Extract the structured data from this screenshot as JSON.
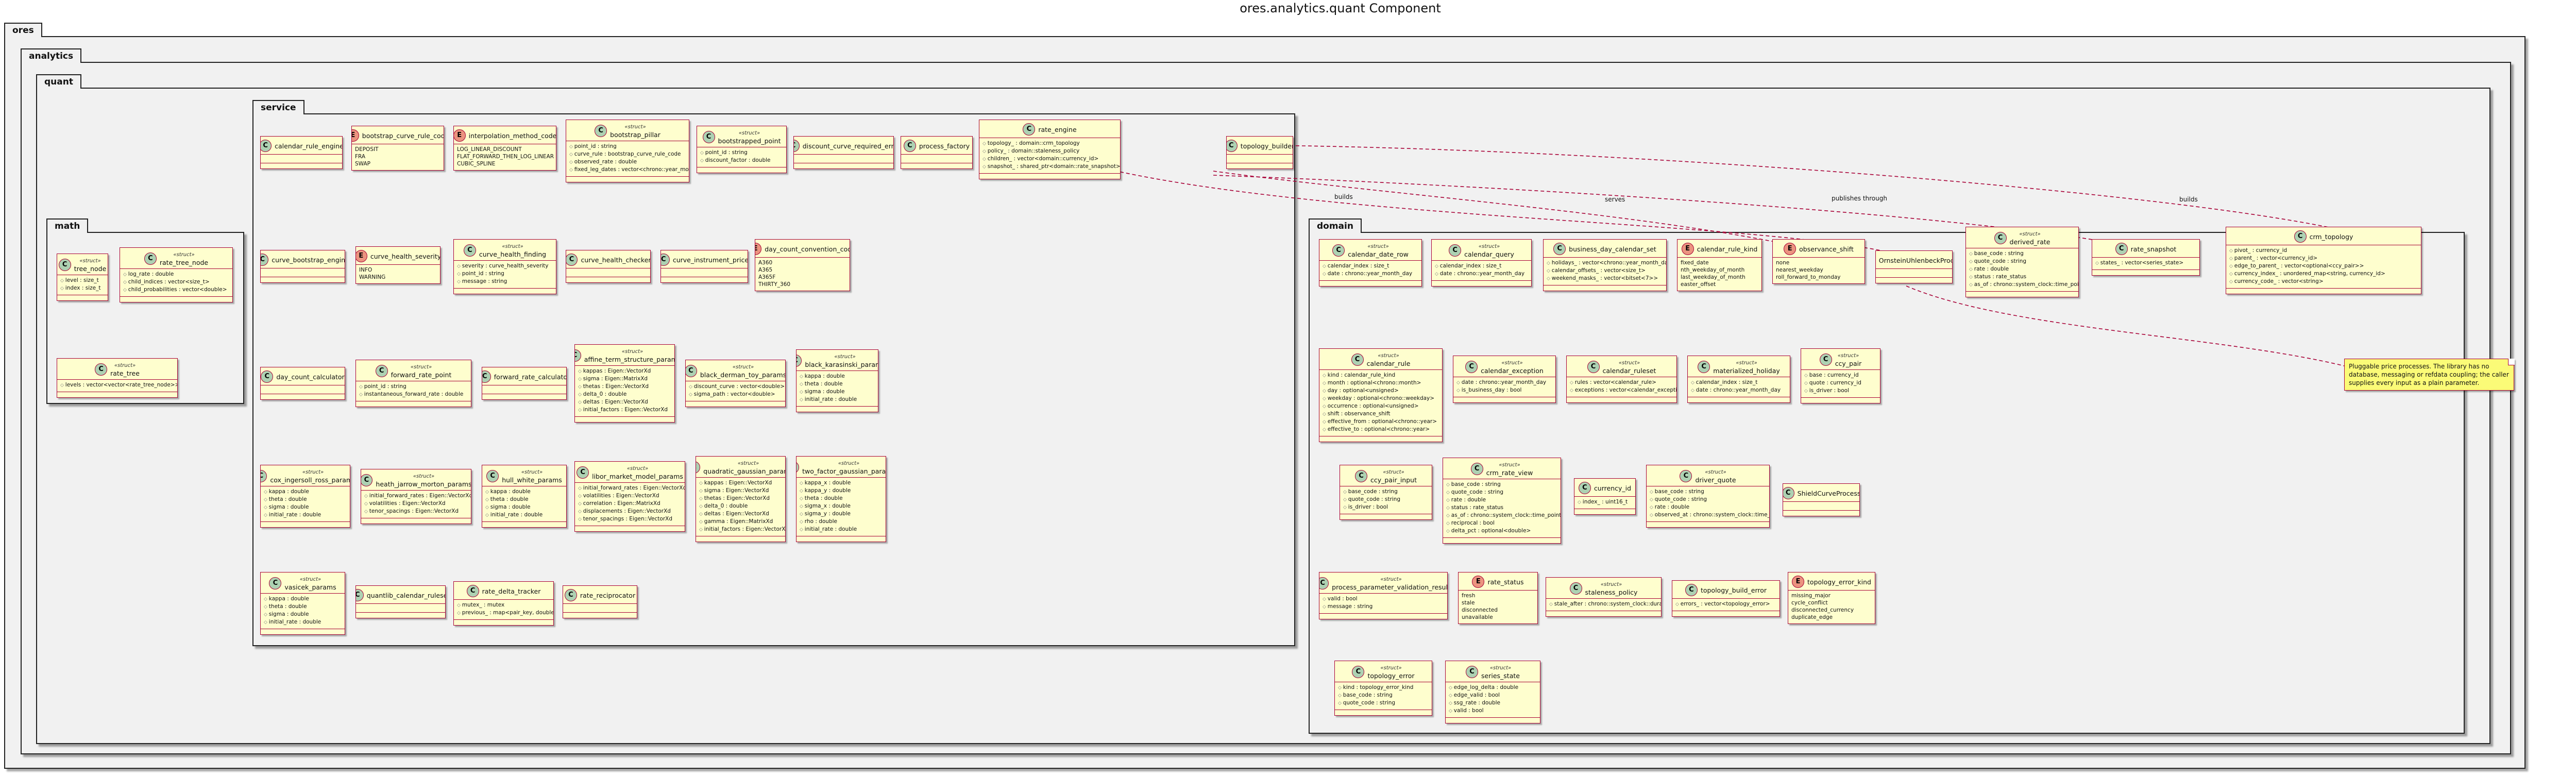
{
  "diagram": {
    "title": "ores.analytics.quant Component",
    "packages": {
      "ores": "ores",
      "analytics": "analytics",
      "quant": "quant",
      "math": "math",
      "service": "service",
      "domain": "domain"
    },
    "classes": {
      "tree_node": {
        "kind": "C",
        "stereotype": "«struct»",
        "name": "tree_node",
        "fields": [
          "level : size_t",
          "index : size_t"
        ]
      },
      "rate_tree_node": {
        "kind": "C",
        "stereotype": "«struct»",
        "name": "rate_tree_node",
        "fields": [
          "log_rate : double",
          "child_indices : vector<size_t>",
          "child_probabilities : vector<double>"
        ]
      },
      "rate_tree": {
        "kind": "C",
        "stereotype": "«struct»",
        "name": "rate_tree",
        "fields": [
          "levels : vector<vector<rate_tree_node>>"
        ]
      },
      "calendar_rule_engine": {
        "kind": "C",
        "name": "calendar_rule_engine",
        "fields": []
      },
      "bootstrap_curve_rule_code": {
        "kind": "E",
        "name": "bootstrap_curve_rule_code",
        "literals": [
          "DEPOSIT",
          "FRA",
          "SWAP"
        ]
      },
      "interpolation_method_code": {
        "kind": "E",
        "name": "interpolation_method_code",
        "literals": [
          "LOG_LINEAR_DISCOUNT",
          "FLAT_FORWARD_THEN_LOG_LINEAR",
          "CUBIC_SPLINE"
        ]
      },
      "bootstrap_pillar": {
        "kind": "C",
        "stereotype": "«struct»",
        "name": "bootstrap_pillar",
        "fields": [
          "point_id : string",
          "curve_rule : bootstrap_curve_rule_code",
          "observed_rate : double",
          "fixed_leg_dates : vector<chrono::year_month_day>"
        ]
      },
      "bootstrapped_point": {
        "kind": "C",
        "stereotype": "«struct»",
        "name": "bootstrapped_point",
        "fields": [
          "point_id : string",
          "discount_factor : double"
        ]
      },
      "discount_curve_required_error": {
        "kind": "C",
        "name": "discount_curve_required_error",
        "fields": []
      },
      "process_factory": {
        "kind": "C",
        "name": "process_factory",
        "fields": []
      },
      "rate_engine": {
        "kind": "C",
        "name": "rate_engine",
        "fields": [
          "topology_ : domain::crm_topology",
          "policy_ : domain::staleness_policy",
          "children_ : vector<domain::currency_id>",
          "snapshot_ : shared_ptr<domain::rate_snapshot>"
        ]
      },
      "topology_builder": {
        "kind": "C",
        "name": "topology_builder",
        "fields": []
      },
      "curve_bootstrap_engine": {
        "kind": "C",
        "name": "curve_bootstrap_engine",
        "fields": []
      },
      "curve_health_severity": {
        "kind": "E",
        "name": "curve_health_severity",
        "literals": [
          "INFO",
          "WARNING"
        ]
      },
      "curve_health_finding": {
        "kind": "C",
        "stereotype": "«struct»",
        "name": "curve_health_finding",
        "fields": [
          "severity : curve_health_severity",
          "point_id : string",
          "message : string"
        ]
      },
      "curve_health_checker": {
        "kind": "C",
        "name": "curve_health_checker",
        "fields": []
      },
      "curve_instrument_pricer": {
        "kind": "C",
        "name": "curve_instrument_pricer",
        "fields": []
      },
      "day_count_convention_code": {
        "kind": "E",
        "name": "day_count_convention_code",
        "literals": [
          "A360",
          "A365",
          "A365F",
          "THIRTY_360"
        ]
      },
      "day_count_calculator": {
        "kind": "C",
        "name": "day_count_calculator",
        "fields": []
      },
      "forward_rate_point": {
        "kind": "C",
        "stereotype": "«struct»",
        "name": "forward_rate_point",
        "fields": [
          "point_id : string",
          "instantaneous_forward_rate : double"
        ]
      },
      "forward_rate_calculator": {
        "kind": "C",
        "name": "forward_rate_calculator",
        "fields": []
      },
      "affine_term_structure_params": {
        "kind": "C",
        "stereotype": "«struct»",
        "name": "affine_term_structure_params",
        "fields": [
          "kappas : Eigen::VectorXd",
          "sigma : Eigen::MatrixXd",
          "thetas : Eigen::VectorXd",
          "delta_0 : double",
          "deltas : Eigen::VectorXd",
          "initial_factors : Eigen::VectorXd"
        ]
      },
      "black_derman_toy_params": {
        "kind": "C",
        "stereotype": "«struct»",
        "name": "black_derman_toy_params",
        "fields": [
          "discount_curve : vector<double>",
          "sigma_path : vector<double>"
        ]
      },
      "black_karasinski_params": {
        "kind": "C",
        "stereotype": "«struct»",
        "name": "black_karasinski_params",
        "fields": [
          "kappa : double",
          "theta : double",
          "sigma : double",
          "initial_rate : double"
        ]
      },
      "cox_ingersoll_ross_params": {
        "kind": "C",
        "stereotype": "«struct»",
        "name": "cox_ingersoll_ross_params",
        "fields": [
          "kappa : double",
          "theta : double",
          "sigma : double",
          "initial_rate : double"
        ]
      },
      "heath_jarrow_morton_params": {
        "kind": "C",
        "stereotype": "«struct»",
        "name": "heath_jarrow_morton_params",
        "fields": [
          "initial_forward_rates : Eigen::VectorXd",
          "volatilities : Eigen::VectorXd",
          "tenor_spacings : Eigen::VectorXd"
        ]
      },
      "hull_white_params": {
        "kind": "C",
        "stereotype": "«struct»",
        "name": "hull_white_params",
        "fields": [
          "kappa : double",
          "theta : double",
          "sigma : double",
          "initial_rate : double"
        ]
      },
      "libor_market_model_params": {
        "kind": "C",
        "stereotype": "«struct»",
        "name": "libor_market_model_params",
        "fields": [
          "initial_forward_rates : Eigen::VectorXd",
          "volatilities : Eigen::VectorXd",
          "correlation : Eigen::MatrixXd",
          "displacements : Eigen::VectorXd",
          "tenor_spacings : Eigen::VectorXd"
        ]
      },
      "quadratic_gaussian_params": {
        "kind": "C",
        "stereotype": "«struct»",
        "name": "quadratic_gaussian_params",
        "fields": [
          "kappas : Eigen::VectorXd",
          "sigma : Eigen::VectorXd",
          "thetas : Eigen::VectorXd",
          "delta_0 : double",
          "deltas : Eigen::VectorXd",
          "gamma : Eigen::MatrixXd",
          "initial_factors : Eigen::VectorXd"
        ]
      },
      "two_factor_gaussian_params": {
        "kind": "C",
        "stereotype": "«struct»",
        "name": "two_factor_gaussian_params",
        "fields": [
          "kappa_x : double",
          "kappa_y : double",
          "theta : double",
          "sigma_x : double",
          "sigma_y : double",
          "rho : double",
          "initial_rate : double"
        ]
      },
      "vasicek_params": {
        "kind": "C",
        "stereotype": "«struct»",
        "name": "vasicek_params",
        "fields": [
          "kappa : double",
          "theta : double",
          "sigma : double",
          "initial_rate : double"
        ]
      },
      "quantlib_calendar_ruleset": {
        "kind": "C",
        "name": "quantlib_calendar_ruleset",
        "fields": []
      },
      "rate_delta_tracker": {
        "kind": "C",
        "name": "rate_delta_tracker",
        "fields": [
          "mutex_ : mutex",
          "previous_ : map<pair_key, double>"
        ]
      },
      "rate_reciprocator": {
        "kind": "C",
        "name": "rate_reciprocator",
        "fields": []
      },
      "calendar_date_row": {
        "kind": "C",
        "stereotype": "«struct»",
        "name": "calendar_date_row",
        "fields": [
          "calendar_index : size_t",
          "date : chrono::year_month_day"
        ]
      },
      "calendar_query": {
        "kind": "C",
        "stereotype": "«struct»",
        "name": "calendar_query",
        "fields": [
          "calendar_index : size_t",
          "date : chrono::year_month_day"
        ]
      },
      "business_day_calendar_set": {
        "kind": "C",
        "name": "business_day_calendar_set",
        "fields": [
          "holidays_ : vector<chrono::year_month_day>",
          "calendar_offsets_ : vector<size_t>",
          "weekend_masks_ : vector<bitset<7>>"
        ]
      },
      "calendar_rule_kind": {
        "kind": "E",
        "name": "calendar_rule_kind",
        "literals": [
          "fixed_date",
          "nth_weekday_of_month",
          "last_weekday_of_month",
          "easter_offset"
        ]
      },
      "observance_shift": {
        "kind": "E",
        "name": "observance_shift",
        "literals": [
          "none",
          "nearest_weekday",
          "roll_forward_to_monday"
        ]
      },
      "sheet_nameless_placeholder": {
        "kind": "C",
        "name": "OrnsteinUhlenbeckProcess",
        "fields": []
      },
      "crm_topology": {
        "kind": "C",
        "name": "crm_topology",
        "fields": [
          "pivot_ : currency_id",
          "parent_ : vector<currency_id>",
          "edge_to_parent_ : vector<optional<ccy_pair>>",
          "currency_index_ : unordered_map<string, currency_id>",
          "currency_code_ : vector<string>"
        ]
      },
      "derived_rate": {
        "kind": "C",
        "stereotype": "«struct»",
        "name": "derived_rate",
        "fields": [
          "base_code : string",
          "quote_code : string",
          "rate : double",
          "status : rate_status",
          "as_of : chrono::system_clock::time_point"
        ]
      },
      "rate_snapshot": {
        "kind": "C",
        "name": "rate_snapshot",
        "fields": [
          "states_ : vector<series_state>"
        ]
      },
      "calendar_rule": {
        "kind": "C",
        "stereotype": "«struct»",
        "name": "calendar_rule",
        "fields": [
          "kind : calendar_rule_kind",
          "month : optional<chrono::month>",
          "day : optional<unsigned>",
          "weekday : optional<chrono::weekday>",
          "occurrence : optional<unsigned>",
          "shift : observance_shift",
          "effective_from : optional<chrono::year>",
          "effective_to : optional<chrono::year>"
        ]
      },
      "calendar_exception": {
        "kind": "C",
        "stereotype": "«struct»",
        "name": "calendar_exception",
        "fields": [
          "date : chrono::year_month_day",
          "is_business_day : bool"
        ]
      },
      "calendar_ruleset": {
        "kind": "C",
        "stereotype": "«struct»",
        "name": "calendar_ruleset",
        "fields": [
          "rules : vector<calendar_rule>",
          "exceptions : vector<calendar_exception>"
        ]
      },
      "materialized_holiday": {
        "kind": "C",
        "stereotype": "«struct»",
        "name": "materialized_holiday",
        "fields": [
          "calendar_index : size_t",
          "date : chrono::year_month_day"
        ]
      },
      "ccy_pair": {
        "kind": "C",
        "stereotype": "«struct»",
        "name": "ccy_pair",
        "fields": [
          "base : currency_id",
          "quote : currency_id",
          "is_driver : bool"
        ]
      },
      "ccy_pair_input": {
        "kind": "C",
        "stereotype": "«struct»",
        "name": "ccy_pair_input",
        "fields": [
          "base_code : string",
          "quote_code : string",
          "is_driver : bool"
        ]
      },
      "crm_rate_view": {
        "kind": "C",
        "stereotype": "«struct»",
        "name": "crm_rate_view",
        "fields": [
          "base_code : string",
          "quote_code : string",
          "rate : double",
          "status : rate_status",
          "as_of : chrono::system_clock::time_point",
          "reciprocal : bool",
          "delta_pct : optional<double>"
        ]
      },
      "currency_id": {
        "kind": "C",
        "name": "currency_id",
        "fields": [
          "index_ : uint16_t"
        ]
      },
      "driver_quote": {
        "kind": "C",
        "stereotype": "«struct»",
        "name": "driver_quote",
        "fields": [
          "base_code : string",
          "quote_code : string",
          "rate : double",
          "observed_at : chrono::system_clock::time_point"
        ]
      },
      "shield_curve_process": {
        "kind": "C",
        "name": "ShieldCurveProcess",
        "fields": []
      },
      "process_parameter_validation_result": {
        "kind": "C",
        "stereotype": "«struct»",
        "name": "process_parameter_validation_result",
        "fields": [
          "valid : bool",
          "message : string"
        ]
      },
      "rate_status": {
        "kind": "E",
        "name": "rate_status",
        "literals": [
          "fresh",
          "stale",
          "disconnected",
          "unavailable"
        ]
      },
      "staleness_policy": {
        "kind": "C",
        "stereotype": "«struct»",
        "name": "staleness_policy",
        "fields": [
          "stale_after : chrono::system_clock::duration"
        ]
      },
      "topology_build_error": {
        "kind": "C",
        "name": "topology_build_error",
        "fields": [
          "errors_ : vector<topology_error>"
        ]
      },
      "topology_error_kind": {
        "kind": "E",
        "name": "topology_error_kind",
        "literals": [
          "missing_major",
          "cycle_conflict",
          "disconnected_currency",
          "duplicate_edge"
        ]
      },
      "topology_error": {
        "kind": "C",
        "stereotype": "«struct»",
        "name": "topology_error",
        "fields": [
          "kind : topology_error_kind",
          "base_code : string",
          "quote_code : string"
        ]
      },
      "series_state": {
        "kind": "C",
        "stereotype": "«struct»",
        "name": "series_state",
        "fields": [
          "edge_log_delta : double",
          "edge_valid : bool",
          "ssg_rate : double",
          "valid : bool"
        ]
      }
    },
    "edges": {
      "builds_1": "builds",
      "builds_2": "builds",
      "serves": "serves",
      "publishes_through": "publishes through"
    },
    "note": "Pluggable price processes. The library has no database, messaging or refdata coupling; the caller supplies every input as a plain parameter."
  }
}
